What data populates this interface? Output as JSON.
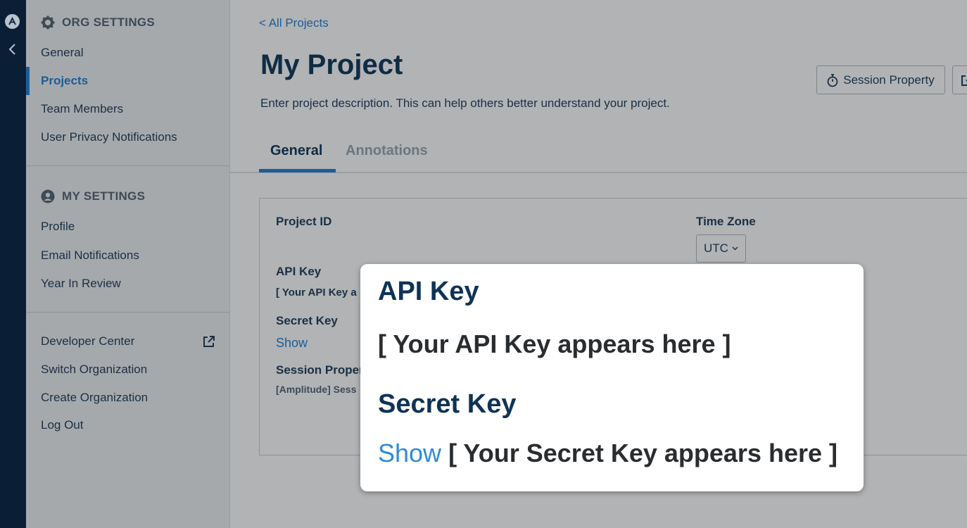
{
  "sidebar": {
    "org_settings_label": "ORG SETTINGS",
    "org_items": [
      "General",
      "Projects",
      "Team Members",
      "User Privacy Notifications"
    ],
    "my_settings_label": "MY SETTINGS",
    "my_items": [
      "Profile",
      "Email Notifications",
      "Year In Review"
    ],
    "bottom_items": [
      "Developer Center",
      "Switch Organization",
      "Create Organization",
      "Log Out"
    ]
  },
  "main": {
    "back_link": "< All Projects",
    "title": "My Project",
    "description": "Enter project description. This can help others better understand your project.",
    "session_button": "Session Property",
    "tabs": [
      "General",
      "Annotations"
    ],
    "fields": {
      "project_id_label": "Project ID",
      "time_zone_label": "Time Zone",
      "time_zone_value": "UTC",
      "api_key_label": "API Key",
      "api_key_value": "[ Your API Key a",
      "secret_key_label": "Secret Key",
      "secret_show": "Show",
      "session_label": "Session Proper",
      "session_value": "[Amplitude] Sess"
    }
  },
  "callout": {
    "api_key_heading": "API Key",
    "api_key_text": "[ Your API Key appears here ]",
    "secret_key_heading": "Secret Key",
    "show_link": "Show",
    "secret_key_text": "[ Your Secret Key appears here ]"
  },
  "colors": {
    "accent": "#1c5d98",
    "rail": "#0a1f36",
    "show_link_callout": "#2d8bd6"
  }
}
